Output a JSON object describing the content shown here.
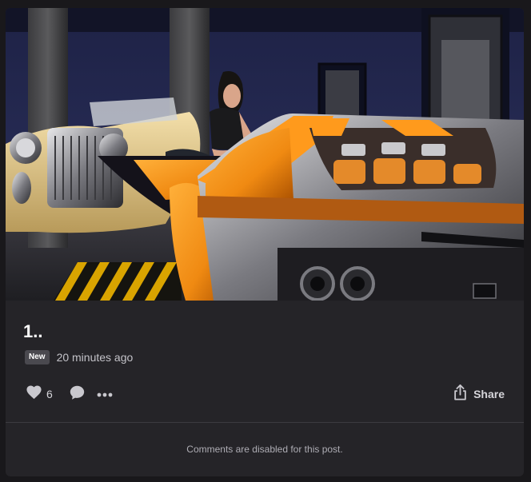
{
  "post": {
    "title": "1..",
    "badge": "New",
    "timestamp": "20 minutes ago",
    "like_count": "6",
    "share_label": "Share",
    "comments_note": "Comments are disabled for this post."
  },
  "icons": {
    "like": "heart-icon",
    "comment": "comment-icon",
    "more": "more-icon",
    "share": "share-icon"
  },
  "colors": {
    "background": "#19181b",
    "card": "#252428",
    "badge": "#4a494f",
    "car_orange": "#f08a12"
  }
}
